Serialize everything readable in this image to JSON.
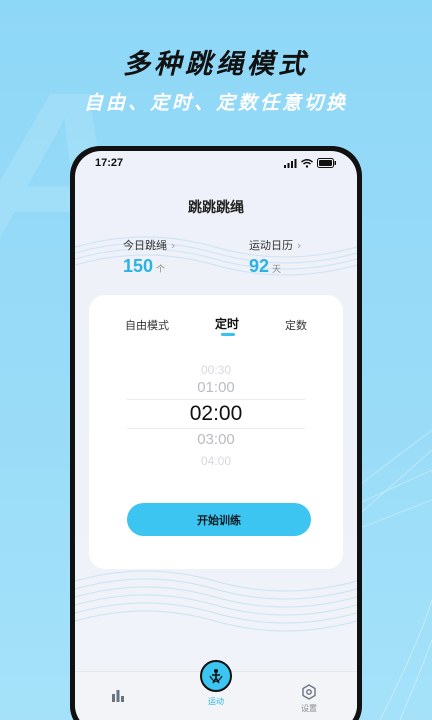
{
  "promo": {
    "title": "多种跳绳模式",
    "subtitle": "自由、定时、定数任意切换"
  },
  "status_bar": {
    "time": "17:27"
  },
  "app": {
    "title": "跳跳跳绳"
  },
  "stats": {
    "today": {
      "label": "今日跳绳",
      "value": "150",
      "unit": "个"
    },
    "calendar": {
      "label": "运动日历",
      "value": "92",
      "unit": "天"
    }
  },
  "modes": {
    "tabs": [
      "自由模式",
      "定时",
      "定数"
    ],
    "selected": "定时"
  },
  "picker": {
    "options": [
      "00:30",
      "01:00",
      "02:00",
      "03:00",
      "04:00"
    ],
    "selected": "02:00"
  },
  "start_button": {
    "label": "开始训练"
  },
  "tabbar": {
    "items": [
      {
        "label": "",
        "icon": "bar-chart-icon"
      },
      {
        "label": "运动",
        "icon": "jump-rope-icon"
      },
      {
        "label": "设置",
        "icon": "gear-icon"
      }
    ],
    "active": "运动"
  },
  "colors": {
    "background": "#9adcf8",
    "accent": "#3cc5f1",
    "accent_text": "#2ab2e4"
  }
}
